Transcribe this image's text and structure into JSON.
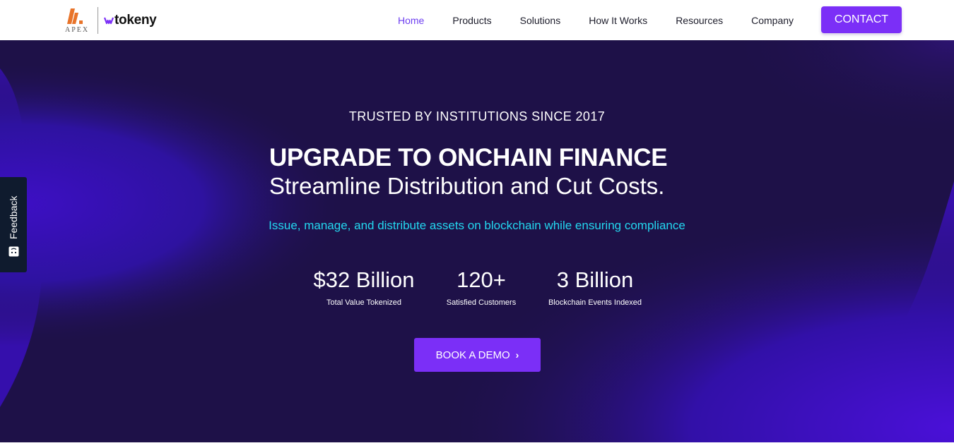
{
  "brand": {
    "apex_text": "APEX",
    "tokeny_text": "tokeny",
    "colors": {
      "apex_orange": "#e8742a",
      "accent_purple": "#7b2ff7",
      "hero_bg": "#1e1148",
      "cyan": "#23d8f0"
    }
  },
  "nav": {
    "items": [
      {
        "label": "Home",
        "active": true
      },
      {
        "label": "Products"
      },
      {
        "label": "Solutions"
      },
      {
        "label": "How It Works"
      },
      {
        "label": "Resources"
      },
      {
        "label": "Company"
      }
    ],
    "contact_label": "CONTACT"
  },
  "hero": {
    "tagline": "TRUSTED BY INSTITUTIONS SINCE 2017",
    "headline": "UPGRADE TO ONCHAIN FINANCE",
    "subheadline": "Streamline Distribution and Cut Costs.",
    "description": "Issue, manage, and distribute assets on blockchain while ensuring compliance",
    "stats": [
      {
        "value": "$32 Billion",
        "label": "Total Value Tokenized"
      },
      {
        "value": "120+",
        "label": "Satisfied Customers"
      },
      {
        "value": "3 Billion",
        "label": "Blockchain Events Indexed"
      }
    ],
    "cta_label": "BOOK A DEMO",
    "cta_icon": "chevron-right-icon"
  },
  "feedback": {
    "label": "Feedback",
    "icon": "feedback-smile-icon"
  }
}
